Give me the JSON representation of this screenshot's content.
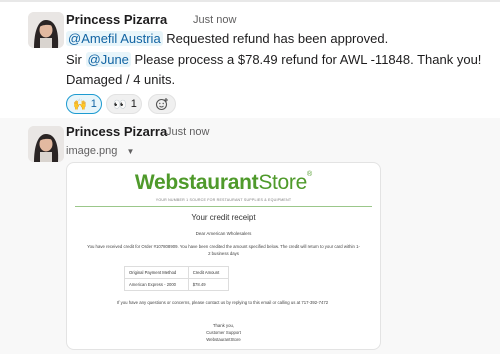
{
  "messages": [
    {
      "author": "Princess Pizarra",
      "time": "Just now",
      "lines": {
        "mention1": "@Amefil Austria",
        "text1": "Requested refund has been approved.",
        "prefix2": "Sir",
        "mention2": "@June",
        "text2": "Please process a $78.49 refund for AWL -11848. Thank you!",
        "text3": "Damaged / 4 units."
      },
      "reactions": [
        {
          "emoji": "🙌",
          "count": "1"
        },
        {
          "emoji": "👀",
          "count": "1"
        }
      ]
    },
    {
      "author": "Princess Pizarra",
      "time": "Just now",
      "file_name": "image.png",
      "receipt": {
        "logo_bold": "Webstaurant",
        "logo_light": "Store",
        "tagline": "YOUR NUMBER 1 SOURCE FOR RESTAURANT SUPPLIES & EQUIPMENT",
        "title": "Your credit receipt",
        "greeting": "Dear American Wholesalers",
        "body": "You have received credit for Order #107808909. You have been credited the amount specified below. The credit will return to your card within 1-2 business days",
        "table": {
          "headers": [
            "Original Payment Method",
            "Credit Amount"
          ],
          "rows": [
            [
              "American Express - 2000",
              "$78.49"
            ]
          ]
        },
        "contact": "If you have any questions or concerns, please contact us by replying to this email or calling us at 717-392-7472",
        "signoff": [
          "Thank you,",
          "Customer Support",
          "WebstaurantStore"
        ]
      }
    }
  ],
  "colors": {
    "mention_bg": "#e8f5fa",
    "mention_text": "#1264a3",
    "reaction_active_border": "#1d9bd1",
    "logo_green": "#4f9a2b"
  },
  "icons": {
    "add_reaction": "add-reaction-icon",
    "file_menu": "caret-down-icon"
  }
}
